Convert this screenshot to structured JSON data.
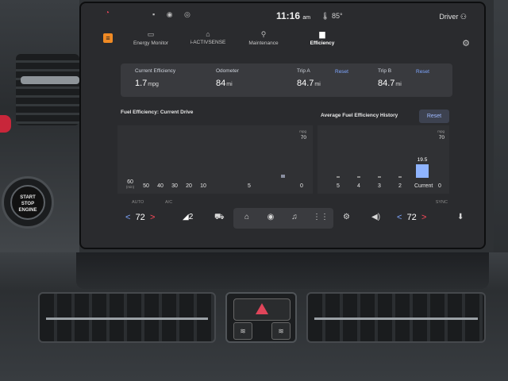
{
  "status": {
    "time": "11:16",
    "time_suffix": "am",
    "temperature": "85°",
    "profile": "Driver"
  },
  "nav": {
    "tabs": [
      {
        "label": "Energy Monitor",
        "icon": "energy-icon"
      },
      {
        "label": "i-ACTIVSENSE",
        "icon": "car-icon"
      },
      {
        "label": "Maintenance",
        "icon": "wrench-icon"
      },
      {
        "label": "Efficiency",
        "icon": "efficiency-icon",
        "active": true
      }
    ]
  },
  "stats": {
    "current_efficiency_label": "Current Efficiency",
    "current_efficiency_value": "1.7",
    "current_efficiency_unit": "mpg",
    "odometer_label": "Odometer",
    "odometer_value": "84",
    "odometer_unit": "mi",
    "trip_a_label": "Trip A",
    "trip_a_value": "84.7",
    "trip_a_unit": "mi",
    "trip_a_reset": "Reset",
    "trip_b_label": "Trip B",
    "trip_b_value": "84.7",
    "trip_b_unit": "mi",
    "trip_b_reset": "Reset"
  },
  "current_drive": {
    "title": "Fuel Efficiency: Current Drive",
    "max_label": "70",
    "max_unit": "mpg",
    "ticks": [
      "60",
      "50",
      "40",
      "30",
      "20",
      "10",
      "5",
      "0"
    ],
    "tick_unit": "(min)"
  },
  "history": {
    "title": "Average Fuel Efficiency History",
    "reset": "Reset",
    "max_label": "70",
    "max_unit": "mpg",
    "ticks": [
      "5",
      "4",
      "3",
      "2",
      "Current",
      "0"
    ],
    "current_value": "19.5"
  },
  "chart_data": [
    {
      "type": "bar",
      "title": "Fuel Efficiency: Current Drive",
      "categories": [
        "60",
        "50",
        "40",
        "30",
        "20",
        "10",
        "5",
        "0"
      ],
      "values": [
        0,
        0,
        0,
        0,
        0,
        0,
        0,
        1.7
      ],
      "xlabel": "(min)",
      "ylabel": "mpg",
      "ylim": [
        0,
        70
      ]
    },
    {
      "type": "bar",
      "title": "Average Fuel Efficiency History",
      "categories": [
        "5",
        "4",
        "3",
        "2",
        "Current"
      ],
      "values": [
        0,
        0,
        0,
        0,
        19.5
      ],
      "ylabel": "mpg",
      "ylim": [
        0,
        70
      ]
    }
  ],
  "strip": {
    "auto": "AUTO",
    "ac": "A/C",
    "sync": "SYNC"
  },
  "climate": {
    "left_temp": "72",
    "right_temp": "72",
    "seat": "2"
  },
  "colors": {
    "accent_blue": "#7ea6ff",
    "bar_blue": "#8fb4ff",
    "arrow_red": "#ff4a5a",
    "logo_orange": "#f08a24"
  }
}
